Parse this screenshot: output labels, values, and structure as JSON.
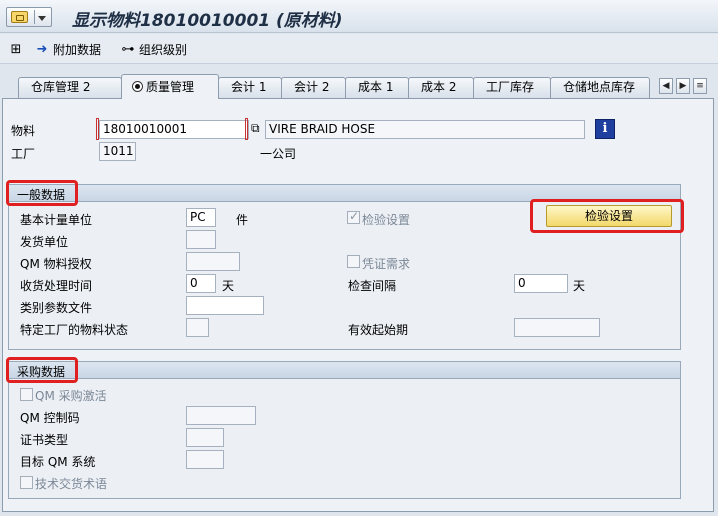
{
  "window": {
    "title": "显示物料18010010001 (原材料)"
  },
  "toolbar": {
    "additional_data": "附加数据",
    "org_levels": "组织级别"
  },
  "tabs": [
    {
      "label": "仓库管理 2"
    },
    {
      "label": "质量管理"
    },
    {
      "label": "会计 1"
    },
    {
      "label": "会计 2"
    },
    {
      "label": "成本 1"
    },
    {
      "label": "成本 2"
    },
    {
      "label": "工厂库存"
    },
    {
      "label": "仓储地点库存"
    }
  ],
  "header": {
    "material_label": "物料",
    "material_value": "18010010001",
    "material_desc": "VIRE BRAID HOSE",
    "plant_label": "工厂",
    "plant_value": "1011",
    "plant_desc": "一公司"
  },
  "general": {
    "title": "一般数据",
    "base_uom_label": "基本计量单位",
    "base_uom_value": "PC",
    "base_uom_text": "件",
    "inspection_setup_chk": "检验设置",
    "inspection_setup_btn": "检验设置",
    "issue_unit_label": "发货单位",
    "qm_auth_label": "QM 物料授权",
    "doc_required": "凭证需求",
    "gr_time_label": "收货处理时间",
    "gr_time_value": "0",
    "gr_time_unit": "天",
    "insp_interval_label": "检查间隔",
    "insp_interval_value": "0",
    "insp_interval_unit": "天",
    "class_profile_label": "类别参数文件",
    "plant_status_label": "特定工厂的物料状态",
    "valid_from_label": "有效起始期"
  },
  "procurement": {
    "title": "采购数据",
    "qm_active": "QM 采购激活",
    "qm_control_label": "QM 控制码",
    "cert_type_label": "证书类型",
    "target_qm_label": "目标 QM 系统",
    "tech_terms": "技术交货术语"
  }
}
